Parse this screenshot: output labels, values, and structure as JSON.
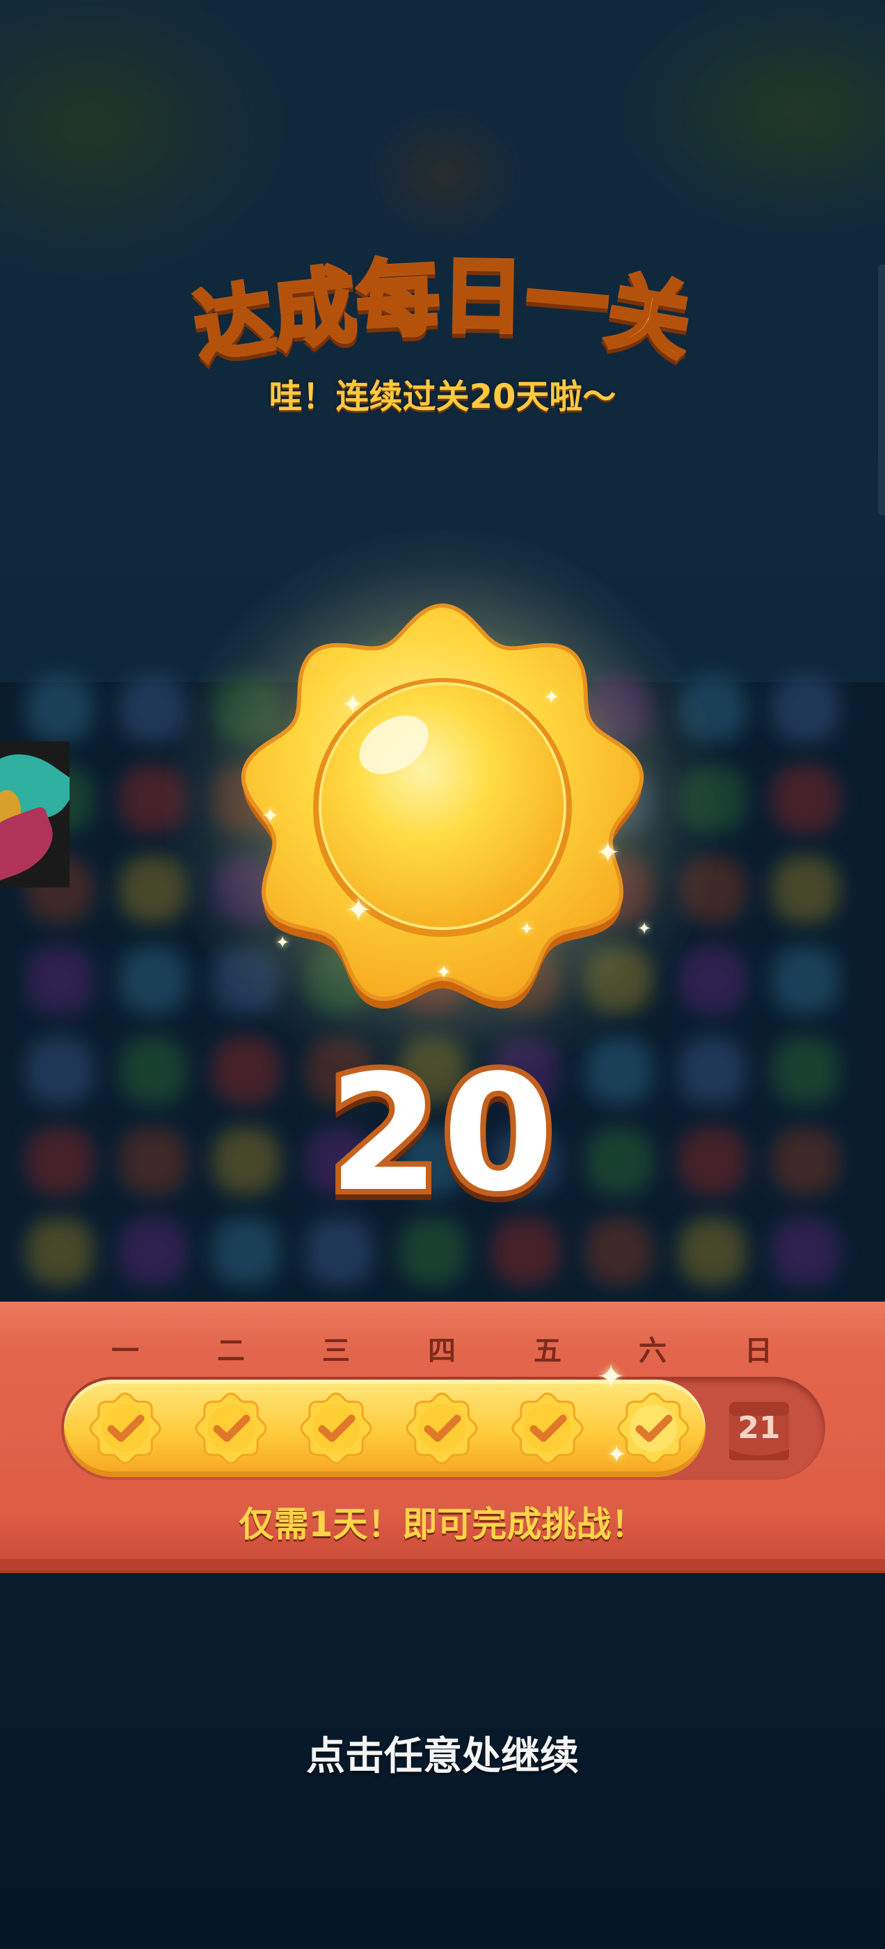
{
  "title": {
    "chars": [
      "达",
      "成",
      "每",
      "日",
      "一",
      "关"
    ]
  },
  "subtitle": "哇！连续过关20天啦～",
  "badge": {
    "icon": "sun-icon",
    "streak_count": "20",
    "colors": {
      "sun_light": "#ffe777",
      "sun_dark": "#f4a21c",
      "outline": "#d77a14"
    }
  },
  "week": {
    "days": [
      "一",
      "二",
      "三",
      "四",
      "五",
      "六",
      "日"
    ],
    "completed_days": 6,
    "total_days": 7,
    "next_day_number": "21",
    "check_icon": "checkmark-icon",
    "calendar_icon": "calendar-icon",
    "banner_color": "#dd5d45"
  },
  "hint": "仅需1天！即可完成挑战！",
  "continue_prompt": "点击任意处继续"
}
